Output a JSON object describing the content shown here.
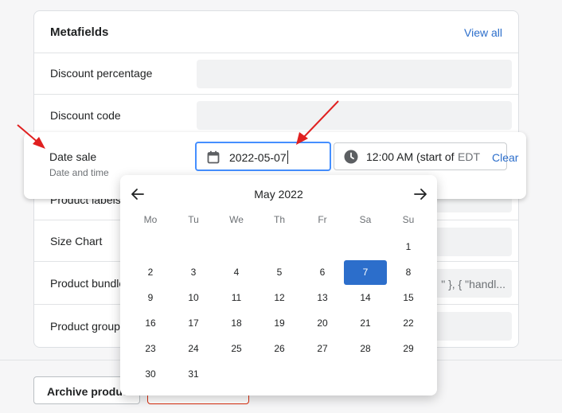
{
  "metafields": {
    "title": "Metafields",
    "view_all": "View all",
    "rows": [
      {
        "label": "Discount percentage",
        "value": ""
      },
      {
        "label": "Discount code",
        "value": ""
      },
      {
        "label": "Product labels",
        "value": ""
      },
      {
        "label": "Size Chart",
        "value": ""
      },
      {
        "label": "Product bundle",
        "value": "\" }, { \"handl..."
      },
      {
        "label": "Product group",
        "value": ""
      }
    ]
  },
  "date_field": {
    "label": "Date sale",
    "sublabel": "Date and time",
    "date_value": "2022-05-07",
    "time_value": "12:00 AM (start of",
    "timezone": "EDT",
    "clear": "Clear"
  },
  "picker": {
    "month": "May 2022",
    "weekdays": [
      "Mo",
      "Tu",
      "We",
      "Th",
      "Fr",
      "Sa",
      "Su"
    ],
    "selected_day": "7",
    "weeks": [
      [
        "",
        "",
        "",
        "",
        "",
        "",
        "1"
      ],
      [
        "2",
        "3",
        "4",
        "5",
        "6",
        "7",
        "8"
      ],
      [
        "9",
        "10",
        "11",
        "12",
        "13",
        "14",
        "15"
      ],
      [
        "16",
        "17",
        "18",
        "19",
        "20",
        "21",
        "22"
      ],
      [
        "23",
        "24",
        "25",
        "26",
        "27",
        "28",
        "29"
      ],
      [
        "30",
        "31",
        "",
        "",
        "",
        "",
        ""
      ]
    ]
  },
  "footer": {
    "archive_label": "Archive product"
  },
  "colors": {
    "accent": "#2c6ecb",
    "focus_ring": "#458fff",
    "annotation_arrow": "#e02020"
  }
}
